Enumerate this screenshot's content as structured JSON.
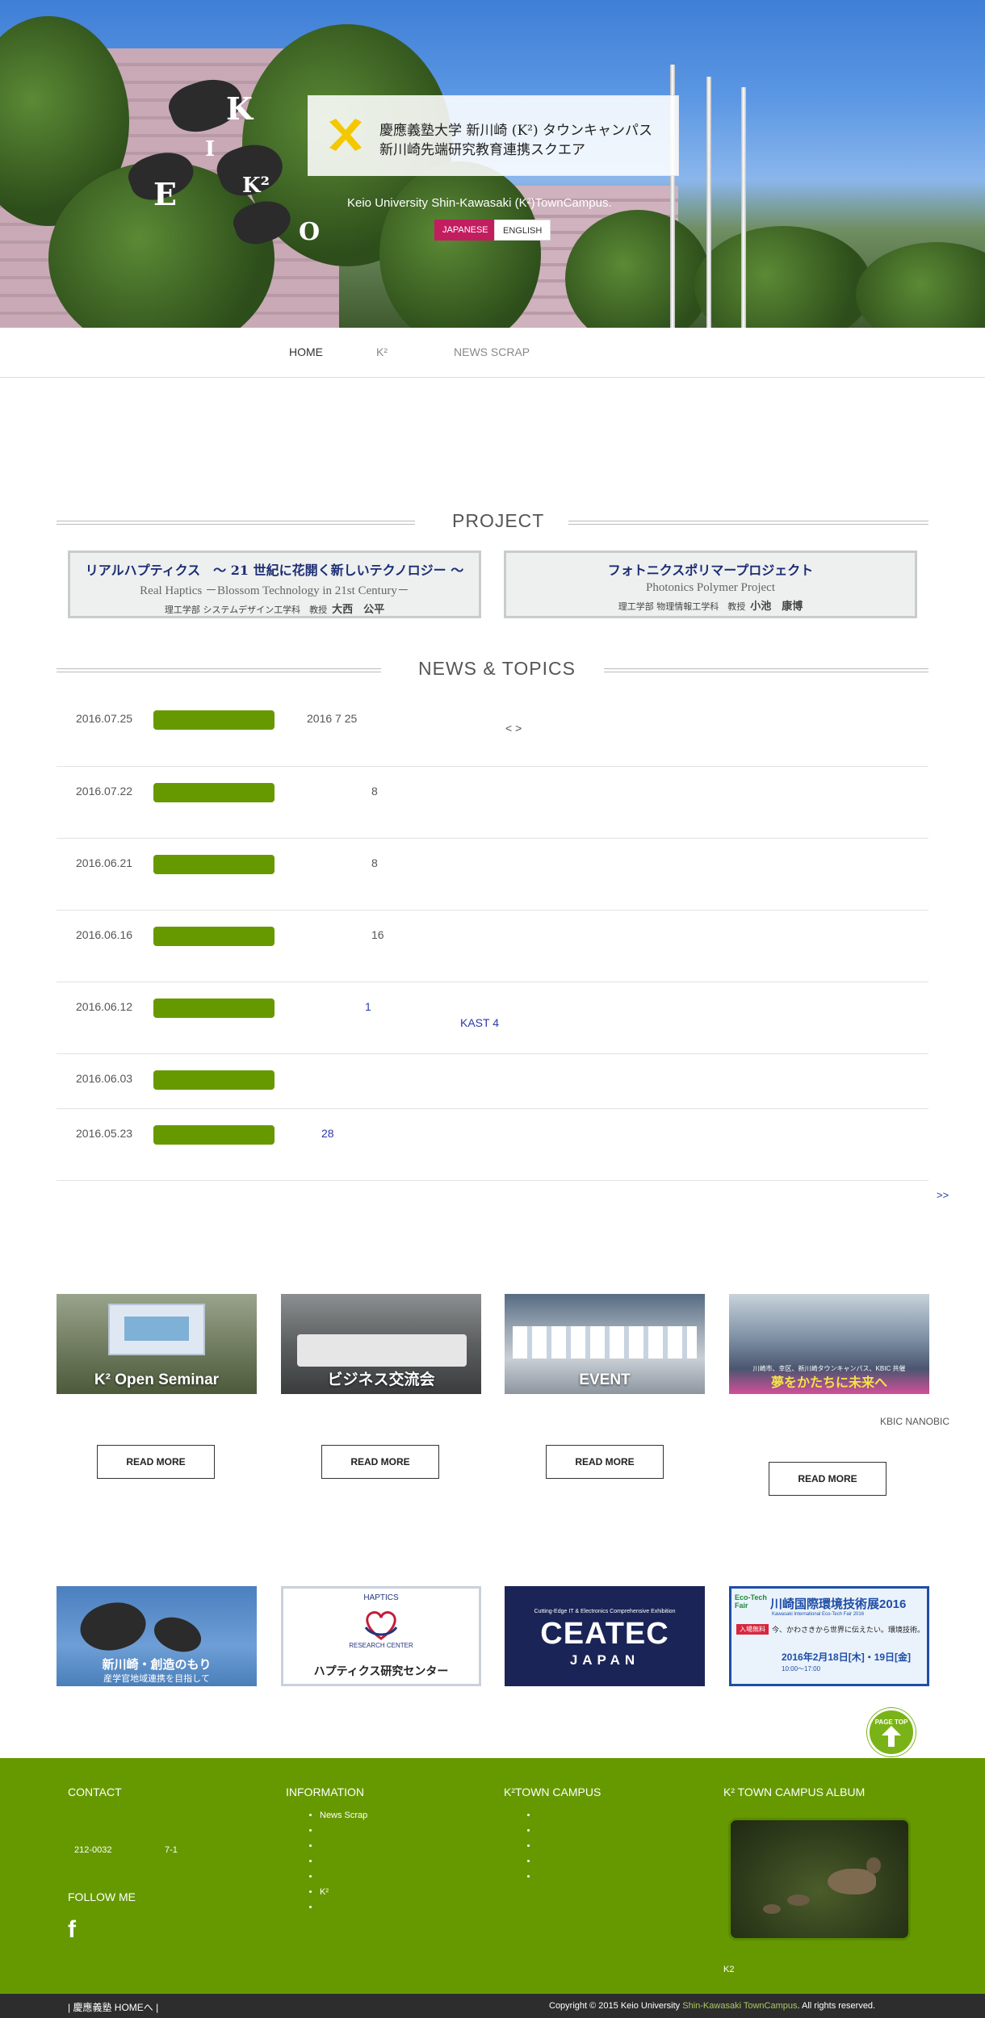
{
  "hero": {
    "title_ja_1": "慶應義塾大学 新川崎 (K²) タウンキャンパス",
    "title_ja_2": "新川崎先端研究教育連携スクエア",
    "title_en": "Keio University Shin-Kawasaki (K²)TownCampus.",
    "lang_japanese": "JAPANESE",
    "lang_english": "ENGLISH",
    "sculpture_letters": [
      "K",
      "E",
      "I",
      "K²",
      "O"
    ]
  },
  "nav": {
    "home": "HOME",
    "k2": "K²",
    "news_scrap": "NEWS SCRAP"
  },
  "project": {
    "heading": "PROJECT",
    "items": [
      {
        "title_ja": "リアルハプティクス　～ 21 世紀に花開く新しいテクノロジー ～",
        "title_en": "Real Haptics －Blossom Technology in 21st Century－",
        "prof_label": "理工学部 システムデザイン工学科　教授",
        "prof_name": "大西　公平"
      },
      {
        "title_ja": "フォトニクスポリマープロジェクト",
        "title_en": "Photonics Polymer Project",
        "prof_label": "理工学部 物理情報工学科　教授",
        "prof_name": "小池　康博"
      }
    ]
  },
  "news": {
    "heading": "NEWS & TOPICS",
    "rows": [
      {
        "date": "2016.07.25",
        "text": "2016  7  25",
        "extra": "<   >"
      },
      {
        "date": "2016.07.22",
        "text": "8"
      },
      {
        "date": "2016.06.21",
        "text": "8"
      },
      {
        "date": "2016.06.16",
        "text": "16"
      },
      {
        "date": "2016.06.12",
        "text": "1",
        "extra": "KAST 4"
      },
      {
        "date": "2016.06.03",
        "text": ""
      },
      {
        "date": "2016.05.23",
        "text": "28"
      }
    ],
    "more": ">>"
  },
  "features": {
    "cards": [
      {
        "caption": "K² Open Seminar",
        "read_more": "READ MORE"
      },
      {
        "caption": "ビジネス交流会",
        "read_more": "READ MORE"
      },
      {
        "caption": "EVENT",
        "read_more": "READ MORE"
      },
      {
        "caption": "",
        "read_more": "READ MORE"
      }
    ],
    "card4_overlay": "川崎市、幸区、新川崎タウンキャンパス、KBIC 共催",
    "card4_overlay_2": "夢をかたちに未来へ",
    "side_note": "KBIC  NANOBIC"
  },
  "banners": {
    "mori_title": "新川崎・創造のもり",
    "mori_sub": "産学官地域連携を目指して",
    "haptics_arc": "HAPTICS",
    "haptics_arc2": "RESEARCH CENTER",
    "haptics_label": "ハプティクス研究センター",
    "ceatec_top": "Cutting-Edge IT & Electronics Comprehensive Exhibition",
    "ceatec_main": "CEATEC",
    "ceatec_sub": "JAPAN",
    "eco_title": "川崎国際環境技術展2016",
    "eco_en": "Kawasaki International Eco-Tech Fair 2016",
    "eco_badge": "入場無料",
    "eco_desc": "今、かわさきから世界に伝えたい。環境技術。",
    "eco_date": "2016年2月18日[木]・19日[金]",
    "eco_time": "10:00〜17:00",
    "eco_logo": "Eco-Tech Fair"
  },
  "pagetop": {
    "label": "PAGE TOP"
  },
  "footer": {
    "contact_title": "CONTACT",
    "postal": "212-0032",
    "address_no": "7-1",
    "follow_title": "FOLLOW ME",
    "facebook_glyph": "f",
    "information_title": "INFORMATION",
    "information_items": [
      "News Scrap",
      "",
      "",
      "",
      "",
      "K²",
      ""
    ],
    "townc_title": "K²TOWN CAMPUS",
    "townc_items": [
      "",
      "",
      "",
      "",
      ""
    ],
    "album_title": "K² TOWN CAMPUS ALBUM",
    "album_caption": "K2",
    "bottom_left": "| 慶應義塾 HOMEへ |",
    "copyright_pre": "Copyright © 2015 Keio University ",
    "copyright_link": "Shin-Kawasaki TownCampus",
    "copyright_post": ". All rights reserved."
  },
  "colors": {
    "accent_green": "#669900",
    "jp_button": "#c21d5f",
    "project_title": "#1c2d74",
    "link_blue": "#2b3aa9"
  }
}
